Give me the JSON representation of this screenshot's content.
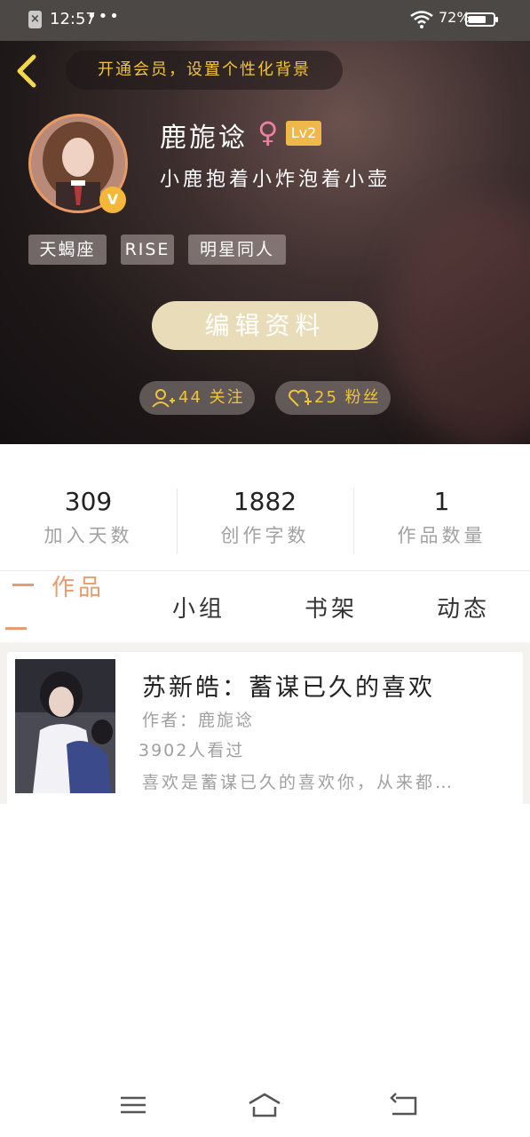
{
  "status_bar": {
    "time": "12:57",
    "dots": "•••",
    "battery_text": "72%",
    "battery_level": 0.72,
    "notification_icon": "close-notification-icon"
  },
  "header": {
    "vip_banner": "开通会员，设置个性化背景",
    "username": "鹿旎谂",
    "gender_symbol": "♀",
    "level": "Lv2",
    "verified_badge": "V",
    "motto": "小鹿抱着小炸泡着小壶",
    "tags": [
      "天蝎座",
      "RISE",
      "明星同人"
    ],
    "edit_button": "编辑资料",
    "following": "44 关注",
    "followers": "25 粉丝"
  },
  "stats": [
    {
      "value": "309",
      "label": "加入天数"
    },
    {
      "value": "1882",
      "label": "创作字数"
    },
    {
      "value": "1",
      "label": "作品数量"
    }
  ],
  "tabs": [
    "作品",
    "小组",
    "书架",
    "动态"
  ],
  "works": [
    {
      "title": "苏新皓：蓄谋已久的喜欢",
      "author": "作者：鹿旎谂",
      "views": "3902人看过",
      "description": "喜欢是蓄谋已久的喜欢你，从来都…"
    }
  ],
  "colors": {
    "accent_orange": "#e69c6e",
    "vip_gold": "#f0c43a",
    "level_badge": "#f0b84b",
    "edit_button": "#e9dcb8"
  }
}
